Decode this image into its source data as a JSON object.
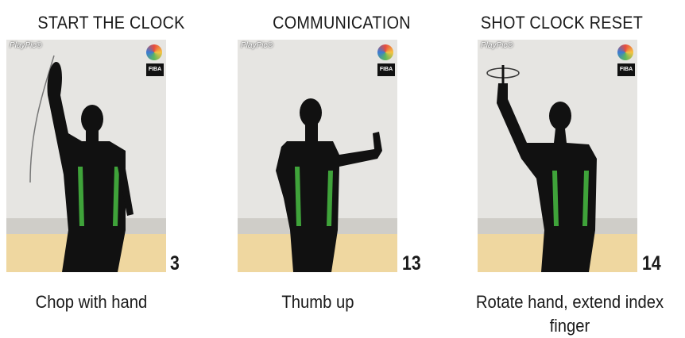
{
  "panels": [
    {
      "title": "START THE CLOCK",
      "number": "3",
      "caption": "Chop with hand",
      "watermark": "PlayPic®",
      "badge": "FIBA",
      "gesture": "chop"
    },
    {
      "title": "COMMUNICATION",
      "number": "13",
      "caption": "Thumb up",
      "watermark": "PlayPic®",
      "badge": "FIBA",
      "gesture": "thumb"
    },
    {
      "title": "SHOT CLOCK RESET",
      "number": "14",
      "caption": "Rotate hand, extend index finger",
      "watermark": "PlayPic®",
      "badge": "FIBA",
      "gesture": "rotate"
    }
  ],
  "colors": {
    "jersey": "#111111",
    "stripe": "#3fa33a",
    "floor": "#efd7a0",
    "wall": "#e4e3e0"
  }
}
